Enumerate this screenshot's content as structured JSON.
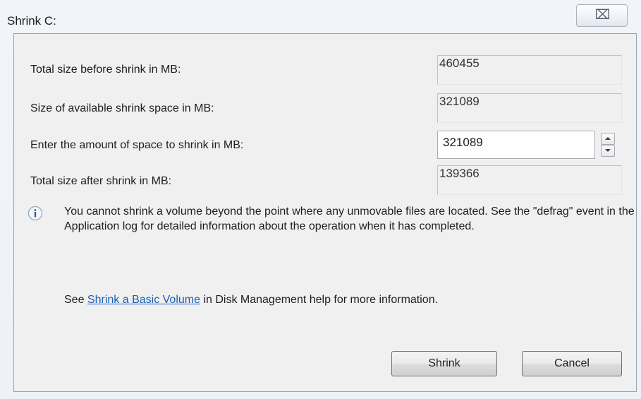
{
  "window": {
    "title": "Shrink C:",
    "close_glyph": "⌧"
  },
  "fields": [
    {
      "label": "Total size before shrink in MB:",
      "value": "460455",
      "editable": false
    },
    {
      "label": "Size of available shrink space in MB:",
      "value": "321089",
      "editable": false
    },
    {
      "label": "Enter the amount of space to shrink in MB:",
      "value": "321089",
      "editable": true
    },
    {
      "label": "Total size after shrink in MB:",
      "value": "139366",
      "editable": false
    }
  ],
  "info": {
    "icon": "info-icon",
    "text": "You cannot shrink a volume beyond the point where any unmovable files are located. See the \"defrag\" event in the Application log for detailed information about the operation when it has completed."
  },
  "help": {
    "prefix": "See ",
    "link_text": "Shrink a Basic Volume",
    "suffix": " in Disk Management help for more information."
  },
  "buttons": {
    "shrink": "Shrink",
    "cancel": "Cancel"
  },
  "colors": {
    "link": "#1a5fb4",
    "panel_bg": "#f0f0f0",
    "frame_bg": "#f1f4f8"
  }
}
